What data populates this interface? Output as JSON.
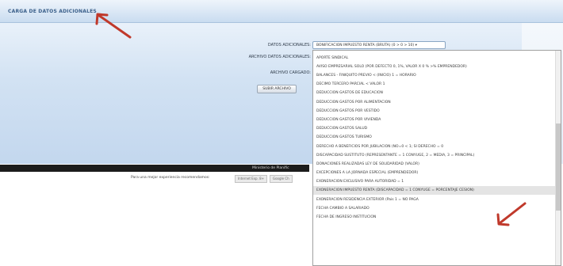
{
  "header": {
    "title": "CARGA DE DATOS ADICIONALES"
  },
  "form": {
    "datos_label": "DATOS ADICIONALES:",
    "archivo_label": "ARCHIVO DATOS ADICIONALES:",
    "cargado_label": "ARCHIVO CARGADO:",
    "select_value": "BONIFICACION IMPUESTO RENTA (BRUTA) (0 > 0 > 10) ▾",
    "upload_button": "SUBIR ARCHIVO"
  },
  "footer": {
    "text": "Ministerio de Planific",
    "browser_note": "Para una mejor experiencia recomendamos:",
    "browser_btn1": "Internet Exp. 8+",
    "browser_btn2": "Google Ch"
  },
  "dropdown": {
    "items": [
      "APORTE SINDICAL",
      "AVISO EMPRESARIAL SOLO (POR DEFECTO 0, 1%, VALOR X 0 % >% EMPRENDEDOR)",
      "BALANCES - FINIQUITO PREVIO < (INICIO) 1 = HORARIO",
      "DECIMO TERCERO PARCIAL < VALOR 1",
      "DEDUCCION GASTOS DE EDUCACION",
      "DEDUCCION GASTOS POR ALIMENTACION",
      "DEDUCCION GASTOS POR VESTIDO",
      "DEDUCCION GASTOS POR VIVIENDA",
      "DEDUCCION GASTOS SALUD",
      "DEDUCCION GASTOS TURISMO",
      "DERECHO A BENEFICIOS POR JUBILACION (NO=0 < 1; SI DERECHO = 0",
      "DISCAPACIDAD SUSTITUTO (REPRESENTANTE = 1 CONYUGE, 2 = MEDIA, 3 = PRINCIPAL)",
      "DONACIONES REALIZADAS LEY DE SOLIDARIDAD (VALOR)",
      "EXCEPCIONES A LA JORNADA ESPECIAL (EMPRENDEDOR)",
      "EXONERACION EXCLUSIVO PARA AUTORIDAD = 1",
      "EXONERACION IMPUESTO RENTA (DISCAPACIDAD = 1 CONYUGE = PORCENTAJE CESION)",
      "EXONERACION RESIDENCIA EXTERIOR (Pais 1 = NO PAGA",
      "FECHA CAMBIO A SALARIADO",
      "FECHA DE INGRESO INSTITUCION"
    ],
    "selected_index": 15
  },
  "colors": {
    "accent": "#3a5f8a",
    "arrow": "#c0392b"
  }
}
